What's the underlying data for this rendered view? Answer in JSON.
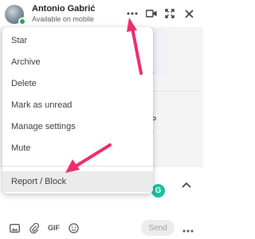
{
  "header": {
    "contact_name": "Antonio Gabrić",
    "status": "Available on mobile",
    "icons": [
      "more-icon",
      "video-call-icon",
      "expand-icon",
      "close-icon"
    ]
  },
  "chat": {
    "partial_chars": [
      "r",
      "P",
      "r"
    ]
  },
  "menu": {
    "items": [
      {
        "label": "Star"
      },
      {
        "label": "Archive"
      },
      {
        "label": "Delete"
      },
      {
        "label": "Mark as unread"
      },
      {
        "label": "Manage settings"
      },
      {
        "label": "Mute"
      },
      {
        "label": "Report / Block"
      }
    ],
    "highlighted_item": "Report / Block"
  },
  "grammarly": {
    "letter": "G"
  },
  "toolbar": {
    "gif_label": "GIF",
    "send_label": "Send"
  },
  "colors": {
    "annotation_arrow": "#ec2d6c",
    "presence": "#2aa35a",
    "grammarly": "#15c39a"
  }
}
